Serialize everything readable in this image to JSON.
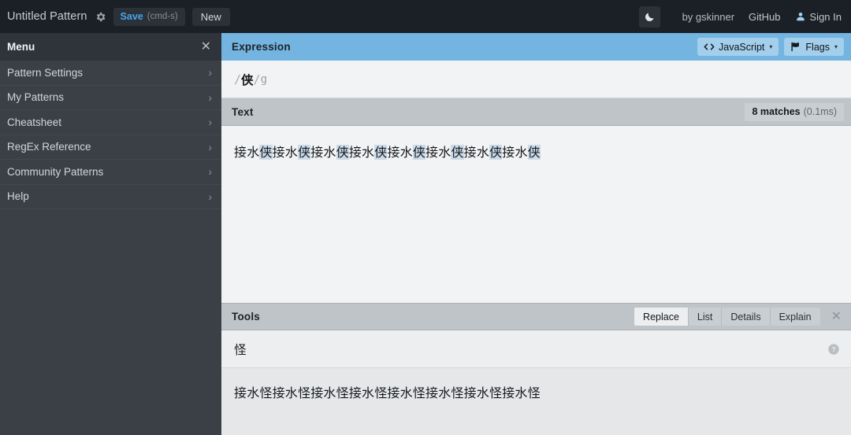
{
  "topbar": {
    "doc_title": "Untitled Pattern",
    "gear_icon": "gear-icon",
    "save_label": "Save",
    "save_hint": "(cmd-s)",
    "new_label": "New",
    "theme_icon": "moon-icon",
    "credit": "by gskinner",
    "github_label": "GitHub",
    "signin_label": "Sign In",
    "signin_icon": "user-icon",
    "bg_color": "#1b2026",
    "accent_color": "#4aa3e8"
  },
  "sidebar": {
    "title": "Menu",
    "close_icon": "close-icon",
    "bg_color": "#3b4046",
    "items": [
      {
        "label": "Pattern Settings",
        "chevron": "chevron-right-icon"
      },
      {
        "label": "My Patterns",
        "chevron": "chevron-right-icon"
      },
      {
        "label": "Cheatsheet",
        "chevron": "chevron-right-icon"
      },
      {
        "label": "RegEx Reference",
        "chevron": "chevron-right-icon"
      },
      {
        "label": "Community Patterns",
        "chevron": "chevron-right-icon"
      },
      {
        "label": "Help",
        "chevron": "chevron-right-icon"
      }
    ]
  },
  "expression": {
    "title": "Expression",
    "header_color": "#74b4e0",
    "flavor_icon": "code-brackets-icon",
    "flavor_label": "JavaScript",
    "flavor_caret": "▾",
    "flags_icon": "flag-icon",
    "flags_label": "Flags",
    "flags_caret": "▾",
    "open_delimiter": "/",
    "close_delimiter": "/",
    "pattern": "侠",
    "flags_value": "g"
  },
  "text_panel": {
    "title": "Text",
    "matches_count": "8 matches",
    "matches_time": "(0.1ms)",
    "segments": [
      {
        "text": "接水",
        "match": false
      },
      {
        "text": "侠",
        "match": true
      },
      {
        "text": "接水",
        "match": false
      },
      {
        "text": "侠",
        "match": true
      },
      {
        "text": "接水",
        "match": false
      },
      {
        "text": "侠",
        "match": true
      },
      {
        "text": "接水",
        "match": false
      },
      {
        "text": "侠",
        "match": true
      },
      {
        "text": "接水",
        "match": false
      },
      {
        "text": "侠",
        "match": true
      },
      {
        "text": "接水",
        "match": false
      },
      {
        "text": "侠",
        "match": true
      },
      {
        "text": "接水",
        "match": false
      },
      {
        "text": "侠",
        "match": true
      },
      {
        "text": "接水",
        "match": false
      },
      {
        "text": "侠",
        "match": true
      }
    ],
    "highlight_color": "#ccdbe9"
  },
  "tools": {
    "title": "Tools",
    "buttons": [
      {
        "label": "Replace",
        "active": true
      },
      {
        "label": "List",
        "active": false
      },
      {
        "label": "Details",
        "active": false
      },
      {
        "label": "Explain",
        "active": false
      }
    ],
    "close_icon": "close-icon",
    "replace_value": "怪",
    "replace_placeholder": "",
    "help_icon": "help-circle-icon",
    "result_text": "接水怪接水怪接水怪接水怪接水怪接水怪接水怪接水怪"
  }
}
